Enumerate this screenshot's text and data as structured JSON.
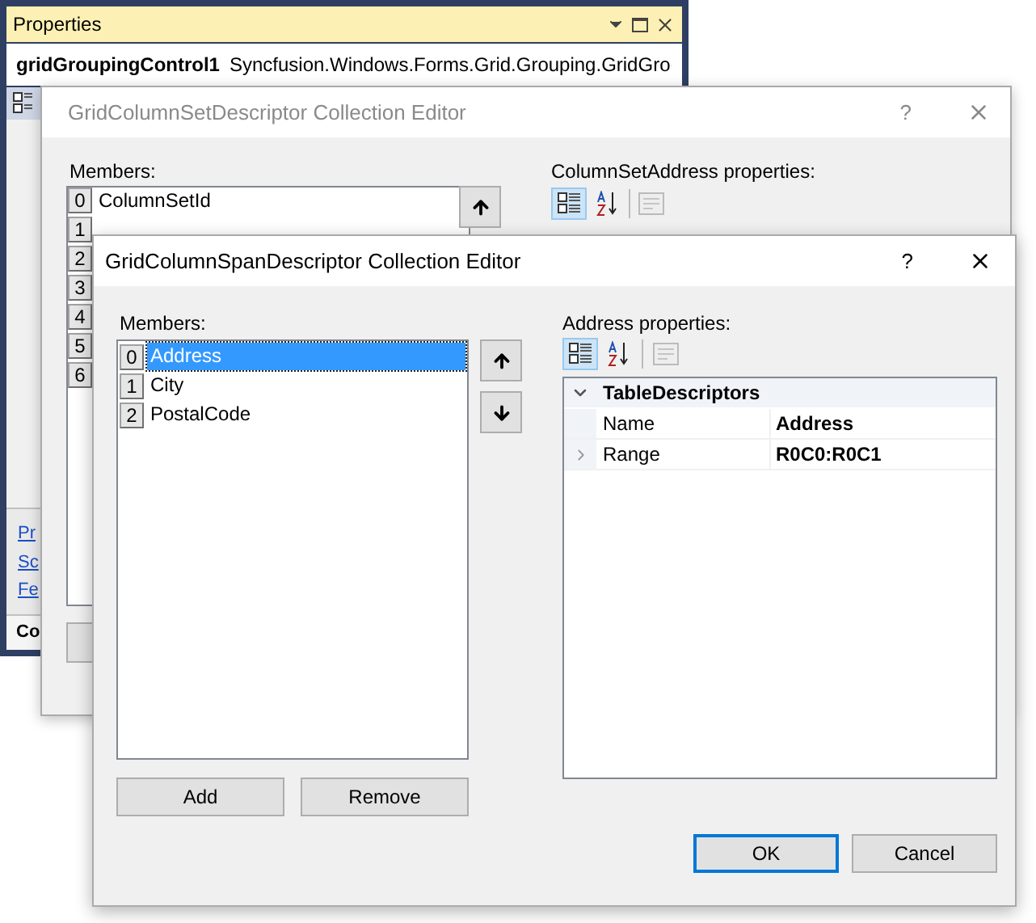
{
  "properties_window": {
    "title": "Properties",
    "object_name": "gridGroupingControl1",
    "object_type": "Syncfusion.Windows.Forms.Grid.Grouping.GridGro",
    "links": [
      "Pr",
      "Sc",
      "Fe"
    ],
    "footer": "Co"
  },
  "back_dialog": {
    "title": "GridColumnSetDescriptor Collection Editor",
    "help": "?",
    "members_label": "Members:",
    "members": [
      {
        "index": "0",
        "name": "ColumnSetId"
      },
      {
        "index": "1"
      },
      {
        "index": "2"
      },
      {
        "index": "3"
      },
      {
        "index": "4"
      },
      {
        "index": "5"
      },
      {
        "index": "6"
      }
    ],
    "properties_label": "ColumnSetAddress properties:"
  },
  "front_dialog": {
    "title": "GridColumnSpanDescriptor Collection Editor",
    "help": "?",
    "members_label": "Members:",
    "members": [
      {
        "index": "0",
        "name": "Address",
        "selected": true
      },
      {
        "index": "1",
        "name": "City",
        "selected": false
      },
      {
        "index": "2",
        "name": "PostalCode",
        "selected": false
      }
    ],
    "properties_label": "Address properties:",
    "toolbar": [
      {
        "kind": "categorized",
        "selected": true
      },
      {
        "kind": "alphabetical",
        "selected": false
      },
      {
        "kind": "pages",
        "selected": false
      }
    ],
    "property_grid": {
      "category": "TableDescriptors",
      "expanded": true,
      "rows": [
        {
          "name": "Name",
          "value": "Address",
          "expandable": false
        },
        {
          "name": "Range",
          "value": "R0C0:R0C1",
          "expandable": true
        }
      ]
    },
    "list_buttons": [
      "Add",
      "Remove"
    ],
    "dialog_buttons": [
      {
        "label": "OK",
        "default": true
      },
      {
        "label": "Cancel",
        "default": false
      }
    ]
  }
}
